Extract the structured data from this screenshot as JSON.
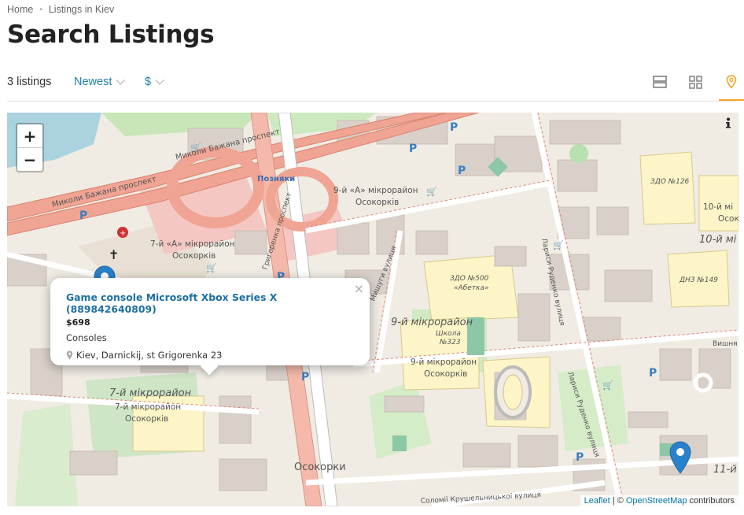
{
  "breadcrumb": {
    "items": [
      "Home",
      "Listings in Kiev"
    ]
  },
  "page": {
    "title": "Search Listings"
  },
  "toolbar": {
    "count": "3 listings",
    "sort_label": "Newest",
    "currency_label": "$",
    "views": [
      "list-view",
      "grid-view",
      "map-view"
    ],
    "active_view": "map-view",
    "accent_color": "#f5a623"
  },
  "map": {
    "zoom_in": "+",
    "zoom_out": "−",
    "labels": {
      "street1": "Миколи Бажана проспект",
      "street2": "Миколи Бажана проспект",
      "metro1": "Позняки",
      "district_a9": "9-й «А» мікрорайон",
      "osokorkiv1": "Осокорків",
      "district_a7": "7-й «А» мікрорайон",
      "osokorkiv2": "Осокорків",
      "grigorenka": "Григоренка проспект",
      "mishugy": "Мишуги вулиця",
      "zdo500": "ЗДО №500",
      "abetka": "«Абетка»",
      "d9": "9-й мікрорайон",
      "shkola": "Школа",
      "n323": "№323",
      "d9b": "9-й мікрорайон",
      "osokorkiv3": "Осокорків",
      "d7": "7-й мікрорайон",
      "d7b": "7-й мікрорайон",
      "osokorkiv4": "Осокорків",
      "metro2": "Осокорки",
      "rudenko1": "Лариси Руденко вулиця",
      "rudenko2": "Лариси Руденко вулиця",
      "zdo126": "ЗДО №126",
      "d10": "10-й мі",
      "d10b": "Осок",
      "d10c": "10-й мі",
      "dnz149": "ДНЗ №149",
      "vyshnya": "Вишня",
      "d11": "11-й",
      "krushelnytska": "Соломії Крушельницької вулиця"
    },
    "attribution": {
      "leaflet": "Leaflet",
      "sep": " | © ",
      "osm": "OpenStreetMap",
      "suffix": " contributors"
    },
    "popup": {
      "title": "Game console Microsoft Xbox Series X (889842640809)",
      "price": "$698",
      "category": "Consoles",
      "address": "Kiev, Darnickij, st Grigorenka 23",
      "close": "×"
    },
    "marker_color": "#2a81cb"
  }
}
